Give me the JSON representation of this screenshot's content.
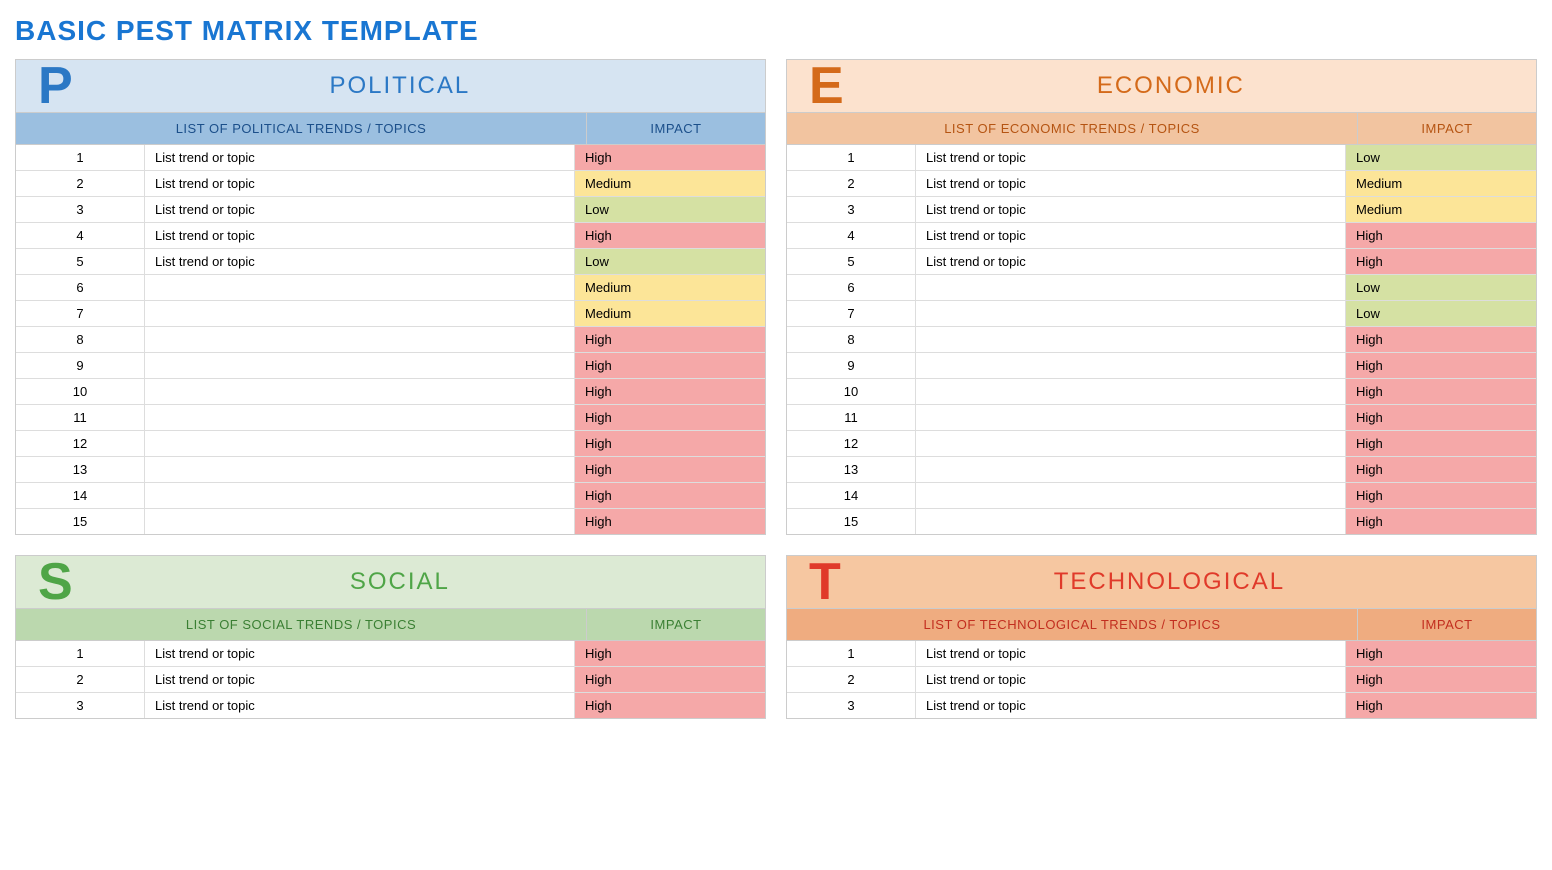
{
  "title": "BASIC PEST MATRIX TEMPLATE",
  "impact_header": "IMPACT",
  "panels": [
    {
      "key": "p",
      "letter": "P",
      "name": "POLITICAL",
      "list_header": "LIST OF POLITICAL TRENDS / TOPICS",
      "rows": [
        {
          "n": "1",
          "topic": "List trend or topic",
          "impact": "High"
        },
        {
          "n": "2",
          "topic": "List trend or topic",
          "impact": "Medium"
        },
        {
          "n": "3",
          "topic": "List trend or topic",
          "impact": "Low"
        },
        {
          "n": "4",
          "topic": "List trend or topic",
          "impact": "High"
        },
        {
          "n": "5",
          "topic": "List trend or topic",
          "impact": "Low"
        },
        {
          "n": "6",
          "topic": "",
          "impact": "Medium"
        },
        {
          "n": "7",
          "topic": "",
          "impact": "Medium"
        },
        {
          "n": "8",
          "topic": "",
          "impact": "High"
        },
        {
          "n": "9",
          "topic": "",
          "impact": "High"
        },
        {
          "n": "10",
          "topic": "",
          "impact": "High"
        },
        {
          "n": "11",
          "topic": "",
          "impact": "High"
        },
        {
          "n": "12",
          "topic": "",
          "impact": "High"
        },
        {
          "n": "13",
          "topic": "",
          "impact": "High"
        },
        {
          "n": "14",
          "topic": "",
          "impact": "High"
        },
        {
          "n": "15",
          "topic": "",
          "impact": "High"
        }
      ]
    },
    {
      "key": "e",
      "letter": "E",
      "name": "ECONOMIC",
      "list_header": "LIST OF ECONOMIC TRENDS / TOPICS",
      "rows": [
        {
          "n": "1",
          "topic": "List trend or topic",
          "impact": "Low"
        },
        {
          "n": "2",
          "topic": "List trend or topic",
          "impact": "Medium"
        },
        {
          "n": "3",
          "topic": "List trend or topic",
          "impact": "Medium"
        },
        {
          "n": "4",
          "topic": "List trend or topic",
          "impact": "High"
        },
        {
          "n": "5",
          "topic": "List trend or topic",
          "impact": "High"
        },
        {
          "n": "6",
          "topic": "",
          "impact": "Low"
        },
        {
          "n": "7",
          "topic": "",
          "impact": "Low"
        },
        {
          "n": "8",
          "topic": "",
          "impact": "High"
        },
        {
          "n": "9",
          "topic": "",
          "impact": "High"
        },
        {
          "n": "10",
          "topic": "",
          "impact": "High"
        },
        {
          "n": "11",
          "topic": "",
          "impact": "High"
        },
        {
          "n": "12",
          "topic": "",
          "impact": "High"
        },
        {
          "n": "13",
          "topic": "",
          "impact": "High"
        },
        {
          "n": "14",
          "topic": "",
          "impact": "High"
        },
        {
          "n": "15",
          "topic": "",
          "impact": "High"
        }
      ]
    },
    {
      "key": "s",
      "letter": "S",
      "name": "SOCIAL",
      "list_header": "LIST OF SOCIAL TRENDS / TOPICS",
      "rows": [
        {
          "n": "1",
          "topic": "List trend or topic",
          "impact": "High"
        },
        {
          "n": "2",
          "topic": "List trend or topic",
          "impact": "High"
        },
        {
          "n": "3",
          "topic": "List trend or topic",
          "impact": "High"
        }
      ]
    },
    {
      "key": "t",
      "letter": "T",
      "name": "TECHNOLOGICAL",
      "list_header": "LIST OF TECHNOLOGICAL TRENDS / TOPICS",
      "rows": [
        {
          "n": "1",
          "topic": "List trend or topic",
          "impact": "High"
        },
        {
          "n": "2",
          "topic": "List trend or topic",
          "impact": "High"
        },
        {
          "n": "3",
          "topic": "List trend or topic",
          "impact": "High"
        }
      ]
    }
  ]
}
